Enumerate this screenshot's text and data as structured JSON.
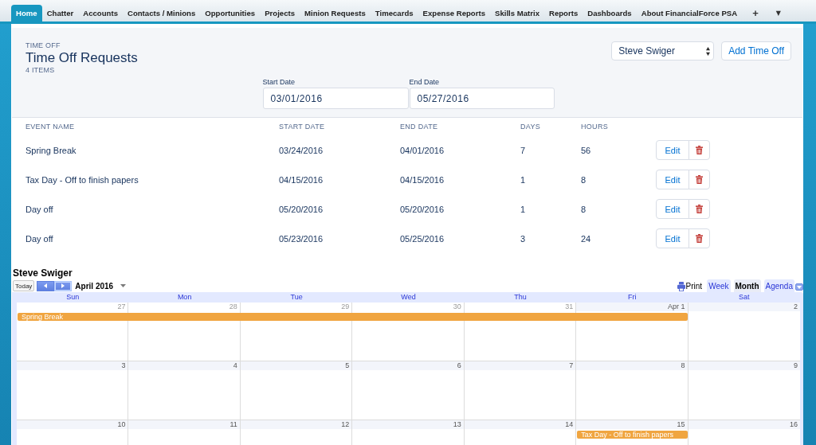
{
  "nav_tabs": [
    {
      "label": "Home",
      "selected": true
    },
    {
      "label": "Chatter",
      "selected": false
    },
    {
      "label": "Accounts",
      "selected": false
    },
    {
      "label": "Contacts / Minions",
      "selected": false
    },
    {
      "label": "Opportunities",
      "selected": false
    },
    {
      "label": "Projects",
      "selected": false
    },
    {
      "label": "Minion Requests",
      "selected": false
    },
    {
      "label": "Timecards",
      "selected": false
    },
    {
      "label": "Expense Reports",
      "selected": false
    },
    {
      "label": "Skills Matrix",
      "selected": false
    },
    {
      "label": "Reports",
      "selected": false
    },
    {
      "label": "Dashboards",
      "selected": false
    },
    {
      "label": "About FinancialForce PSA",
      "selected": false
    }
  ],
  "nav_icons": [
    "+",
    "▼"
  ],
  "header": {
    "eyebrow": "TIME OFF",
    "title": "Time Off Requests",
    "count": "4 ITEMS",
    "resource": "Steve Swiger",
    "add_button": "Add Time Off"
  },
  "filters": [
    {
      "label": "Start Date",
      "value": "03/01/2016"
    },
    {
      "label": "End Date",
      "value": "05/27/2016"
    }
  ],
  "table": {
    "columns": [
      "EVENT NAME",
      "START DATE",
      "END DATE",
      "DAYS",
      "HOURS"
    ],
    "rows": [
      {
        "cells": [
          "Spring Break",
          "03/24/2016",
          "04/01/2016",
          "7",
          "56"
        ],
        "action": "Edit"
      },
      {
        "cells": [
          "Tax Day - Off to finish papers",
          "04/15/2016",
          "04/15/2016",
          "1",
          "8"
        ],
        "action": "Edit"
      },
      {
        "cells": [
          "Day off",
          "05/20/2016",
          "05/20/2016",
          "1",
          "8"
        ],
        "action": "Edit"
      },
      {
        "cells": [
          "Day off",
          "05/23/2016",
          "05/25/2016",
          "3",
          "24"
        ],
        "action": "Edit"
      }
    ]
  },
  "calendar": {
    "title": "Steve Swiger",
    "today_button": "Today",
    "month": "April 2016",
    "print": "Print",
    "views": [
      {
        "label": "Week",
        "selected": false
      },
      {
        "label": "Month",
        "selected": true
      },
      {
        "label": "Agenda",
        "selected": false
      }
    ],
    "weekdays": [
      "Sun",
      "Mon",
      "Tue",
      "Wed",
      "Thu",
      "Fri",
      "Sat"
    ],
    "weeks": [
      {
        "days": [
          {
            "label": "27",
            "in_month": false,
            "continued": false,
            "event": {
              "title": "Spring Break"
            }
          },
          {
            "label": "28",
            "in_month": false,
            "continued": true
          },
          {
            "label": "29",
            "in_month": false,
            "continued": true
          },
          {
            "label": "30",
            "in_month": false,
            "continued": true
          },
          {
            "label": "31",
            "in_month": false,
            "continued": true
          },
          {
            "label": "Apr 1",
            "in_month": true,
            "continued": true
          },
          {
            "label": "2",
            "in_month": true,
            "continued": false
          }
        ]
      },
      {
        "days": [
          {
            "label": "3",
            "in_month": true,
            "continued": false
          },
          {
            "label": "4",
            "in_month": true,
            "continued": false
          },
          {
            "label": "5",
            "in_month": true,
            "continued": false
          },
          {
            "label": "6",
            "in_month": true,
            "continued": false
          },
          {
            "label": "7",
            "in_month": true,
            "continued": false
          },
          {
            "label": "8",
            "in_month": true,
            "continued": false
          },
          {
            "label": "9",
            "in_month": true,
            "continued": false
          }
        ]
      },
      {
        "days": [
          {
            "label": "10",
            "in_month": true,
            "continued": false
          },
          {
            "label": "11",
            "in_month": true,
            "continued": false
          },
          {
            "label": "12",
            "in_month": true,
            "continued": false
          },
          {
            "label": "13",
            "in_month": true,
            "continued": false
          },
          {
            "label": "14",
            "in_month": true,
            "continued": false
          },
          {
            "label": "15",
            "in_month": true,
            "continued": false,
            "event": {
              "title": "Tax Day - Off to finish papers"
            }
          },
          {
            "label": "16",
            "in_month": true,
            "continued": false
          }
        ]
      }
    ]
  }
}
